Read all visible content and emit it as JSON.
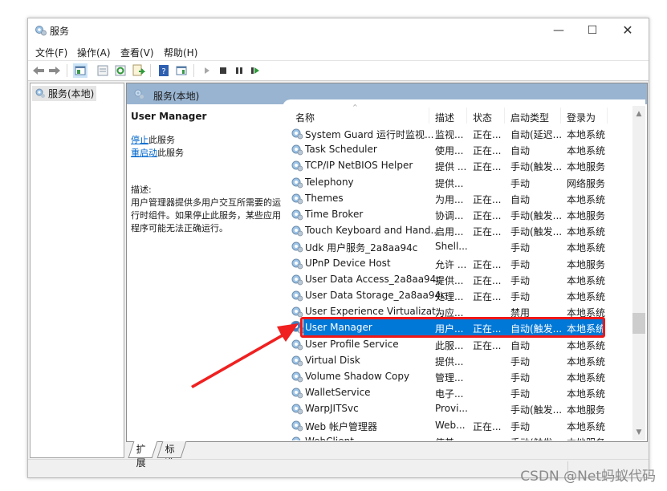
{
  "window": {
    "title": "服务",
    "minimize_glyph": "—",
    "maximize_glyph": "☐",
    "close_glyph": "✕"
  },
  "menu": [
    "文件(F)",
    "操作(A)",
    "查看(V)",
    "帮助(H)"
  ],
  "toolbar": {
    "buttons": [
      "back-icon",
      "forward-icon",
      "show-hide-console-tree-icon",
      "properties-icon",
      "refresh-icon",
      "export-list-icon",
      "help-icon",
      "show-hide-action-pane-icon",
      "start-service-icon",
      "stop-service-icon",
      "pause-service-icon",
      "restart-service-icon"
    ]
  },
  "tree": {
    "root": "服务(本地)"
  },
  "pane": {
    "header": "服务(本地)",
    "selected_name": "User Manager",
    "stop_link": "停止",
    "stop_suffix": "此服务",
    "restart_link": "重启动",
    "restart_suffix": "此服务",
    "desc_label": "描述:",
    "desc_text": "用户管理器提供多用户交互所需要的运行时组件。如果停止此服务，某些应用程序可能无法正确运行。"
  },
  "list": {
    "columns": [
      "名称",
      "描述",
      "状态",
      "启动类型",
      "登录为"
    ],
    "sorted_column": "名称",
    "rows": [
      {
        "name": "System Guard 运行时监视...",
        "desc": "监视...",
        "status": "正在...",
        "start": "自动(延迟...",
        "logon": "本地系统"
      },
      {
        "name": "Task Scheduler",
        "desc": "使用...",
        "status": "正在...",
        "start": "自动",
        "logon": "本地系统"
      },
      {
        "name": "TCP/IP NetBIOS Helper",
        "desc": "提供 ...",
        "status": "正在...",
        "start": "手动(触发...",
        "logon": "本地服务"
      },
      {
        "name": "Telephony",
        "desc": "提供...",
        "status": "",
        "start": "手动",
        "logon": "网络服务"
      },
      {
        "name": "Themes",
        "desc": "为用...",
        "status": "正在...",
        "start": "自动",
        "logon": "本地系统"
      },
      {
        "name": "Time Broker",
        "desc": "协调...",
        "status": "正在...",
        "start": "手动(触发...",
        "logon": "本地服务"
      },
      {
        "name": "Touch Keyboard and Hand...",
        "desc": "启用...",
        "status": "正在...",
        "start": "手动(触发...",
        "logon": "本地系统"
      },
      {
        "name": "Udk 用户服务_2a8aa94c",
        "desc": "Shell...",
        "status": "",
        "start": "手动",
        "logon": "本地系统"
      },
      {
        "name": "UPnP Device Host",
        "desc": "允许 ...",
        "status": "正在...",
        "start": "手动",
        "logon": "本地服务"
      },
      {
        "name": "User Data Access_2a8aa94c",
        "desc": "提供...",
        "status": "正在...",
        "start": "手动",
        "logon": "本地系统"
      },
      {
        "name": "User Data Storage_2a8aa94c",
        "desc": "处理...",
        "status": "正在...",
        "start": "手动",
        "logon": "本地系统"
      },
      {
        "name": "User Experience Virtualizat...",
        "desc": "为应...",
        "status": "",
        "start": "禁用",
        "logon": "本地系统"
      },
      {
        "name": "User Manager",
        "desc": "用户...",
        "status": "正在...",
        "start": "自动(触发...",
        "logon": "本地系统",
        "selected": true
      },
      {
        "name": "User Profile Service",
        "desc": "此服...",
        "status": "正在...",
        "start": "自动",
        "logon": "本地系统"
      },
      {
        "name": "Virtual Disk",
        "desc": "提供...",
        "status": "",
        "start": "手动",
        "logon": "本地系统"
      },
      {
        "name": "Volume Shadow Copy",
        "desc": "管理...",
        "status": "",
        "start": "手动",
        "logon": "本地系统"
      },
      {
        "name": "WalletService",
        "desc": "电子...",
        "status": "",
        "start": "手动",
        "logon": "本地系统"
      },
      {
        "name": "WarpJITSvc",
        "desc": "Provi...",
        "status": "",
        "start": "手动(触发...",
        "logon": "本地服务"
      },
      {
        "name": "Web 帐户管理器",
        "desc": "Web...",
        "status": "正在...",
        "start": "手动",
        "logon": "本地系统"
      },
      {
        "name": "WebClient",
        "desc": "使基...",
        "status": "",
        "start": "手动(触发...",
        "logon": "本地服务"
      }
    ],
    "scroll_position": 0.62
  },
  "tabs": [
    "扩展",
    "标准"
  ],
  "active_tab": "扩展",
  "annotation": {
    "color": "#f01818",
    "target": "User Manager"
  },
  "watermark": "CSDN @Net蚂蚁代码"
}
